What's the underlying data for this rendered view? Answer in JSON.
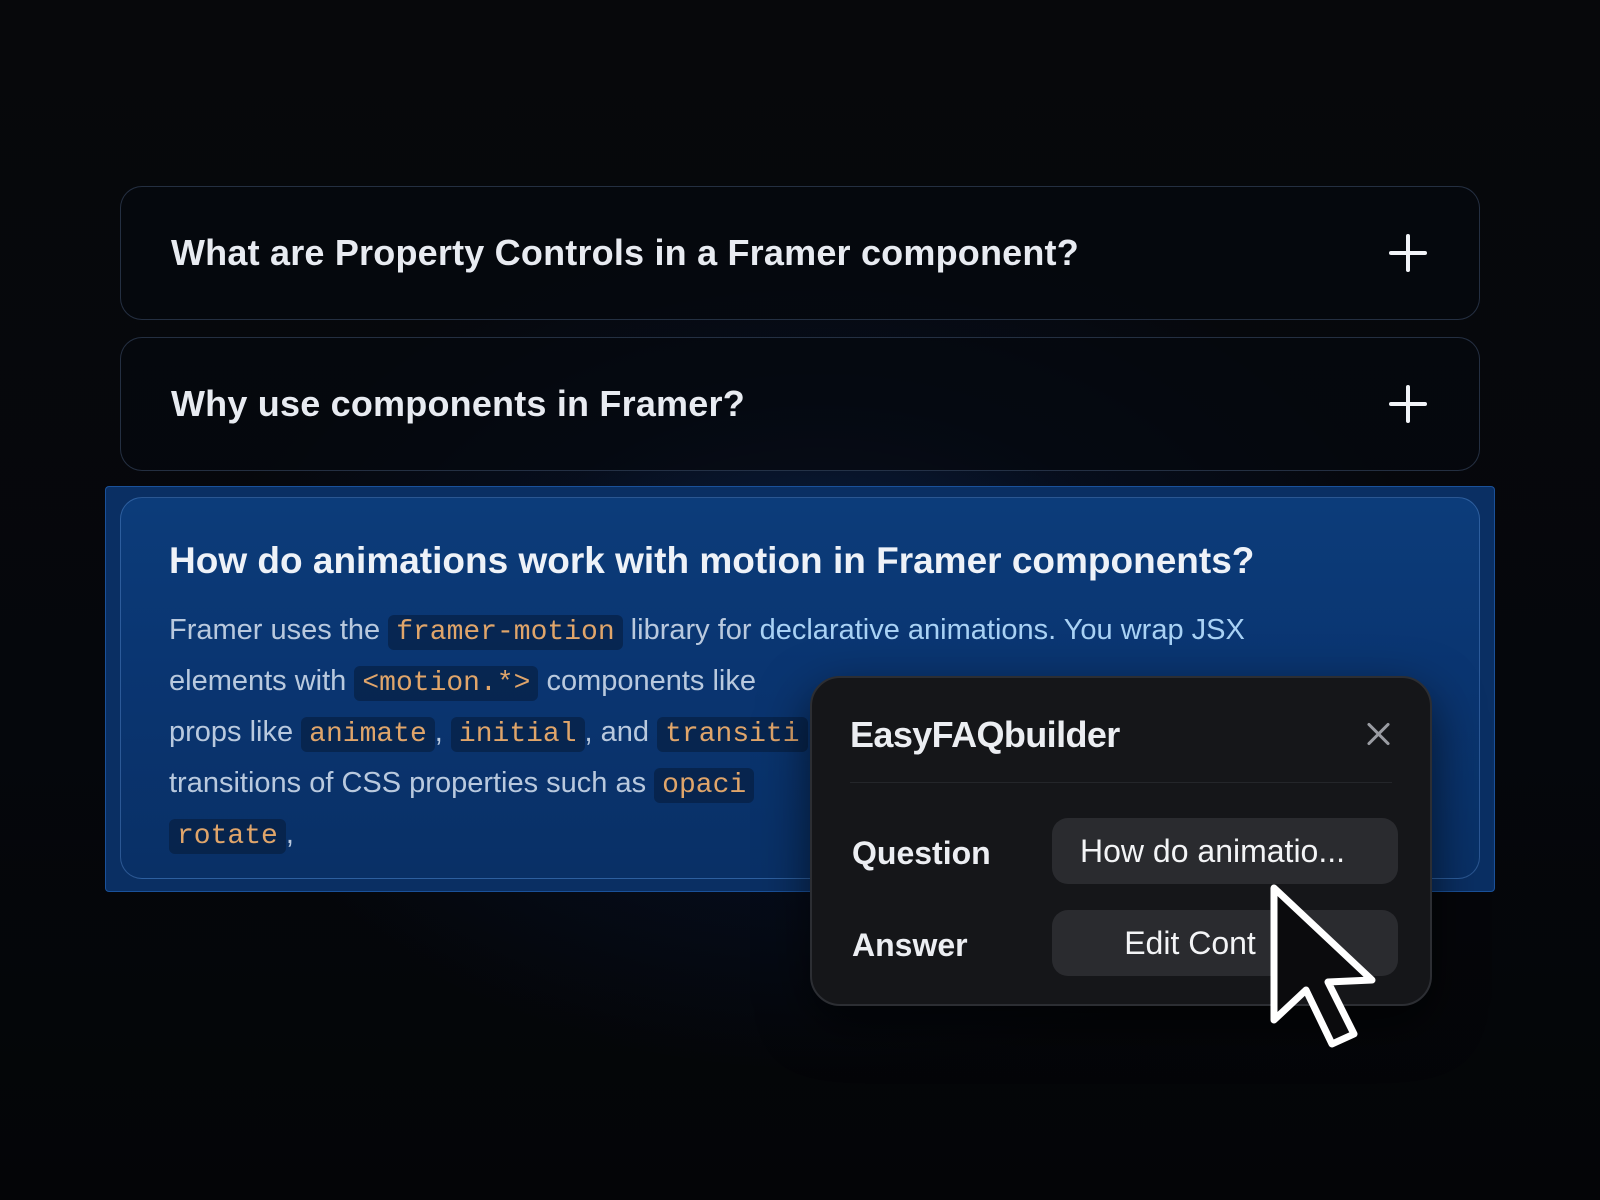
{
  "faq": {
    "items": [
      {
        "question": "What are Property Controls in a Framer component?",
        "icon": "plus-icon"
      },
      {
        "question": "Why use components in Framer?",
        "icon": "plus-icon"
      }
    ],
    "open_item": {
      "question": "How do animations work with motion in Framer components?",
      "answer": {
        "t1": "Framer uses the ",
        "c1": "framer-motion",
        "t2": " library for ",
        "t3": "declarative animations. You wrap JSX",
        "t4": " elements with ",
        "c2": "<motion.*>",
        "t5": " components like",
        "t6": " props like ",
        "c3": "animate",
        "t7": ", ",
        "c4": "initial",
        "t8": ", and ",
        "c5": "transiti",
        "t9": " transitions of CSS properties such as ",
        "c6": "opaci",
        "c7": "rotate",
        "t10": ","
      }
    }
  },
  "dialog": {
    "title": "EasyFAQbuilder",
    "close_icon": "close-icon",
    "question_label": "Question",
    "question_value": "How do animatio...",
    "answer_label": "Answer",
    "answer_button": "Edit Cont"
  },
  "colors": {
    "accent_blue": "#0a3571",
    "code_orange": "#e0a56a",
    "dialog_bg": "#151619"
  }
}
